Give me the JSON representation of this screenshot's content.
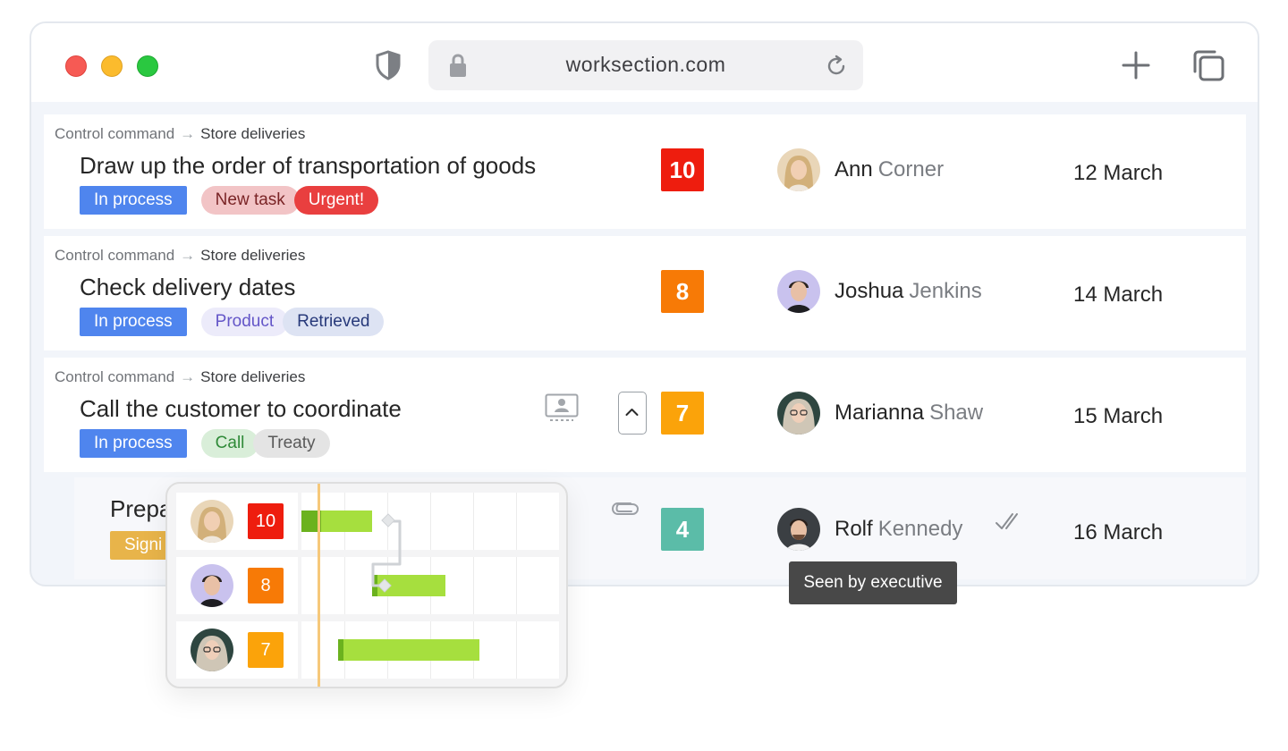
{
  "browser": {
    "url": "worksection.com"
  },
  "tasks": [
    {
      "crumb_group": "Control command",
      "crumb_project": "Store deliveries",
      "title": "Draw up the order of transportation of goods",
      "status": "In process",
      "tags": [
        "New task",
        "Urgent!"
      ],
      "count": "10",
      "first_name": "Ann",
      "last_name": "Corner",
      "date": "12 March"
    },
    {
      "crumb_group": "Control command",
      "crumb_project": "Store deliveries",
      "title": "Check delivery dates",
      "status": "In process",
      "tags": [
        "Product",
        "Retrieved"
      ],
      "count": "8",
      "first_name": "Joshua",
      "last_name": "Jenkins",
      "date": "14 March"
    },
    {
      "crumb_group": "Control command",
      "crumb_project": "Store deliveries",
      "title": "Call the customer to coordinate",
      "status": "In process",
      "tags": [
        "Call",
        "Treaty"
      ],
      "count": "7",
      "first_name": "Marianna",
      "last_name": "Shaw",
      "date": "15 March"
    },
    {
      "title": "Prepa",
      "status": "Signi",
      "count": "4",
      "first_name": "Rolf",
      "last_name": "Kennedy",
      "date": "16 March"
    }
  ],
  "tooltip": "Seen by executive",
  "gantt": [
    {
      "count": "10",
      "start_frac": 0.0,
      "end_frac": 0.33
    },
    {
      "count": "8",
      "start_frac": 0.33,
      "end_frac": 0.67
    },
    {
      "count": "7",
      "start_frac": 0.17,
      "end_frac": 0.83
    }
  ],
  "colors": {
    "status_blue": "#4f85ee",
    "badge_red": "#ee1d0e",
    "badge_orange": "#f77a06",
    "badge_amber": "#fba30a",
    "badge_teal": "#5bbca8",
    "tag_new_bg": "#f2c4c6",
    "tag_urgent_bg": "#e93f3f",
    "tag_product_bg": "#ecebfa",
    "tag_retrieved_bg": "#dde3f3",
    "tag_call_bg": "#d9eed9",
    "tag_treaty_bg": "#e4e4e4"
  }
}
